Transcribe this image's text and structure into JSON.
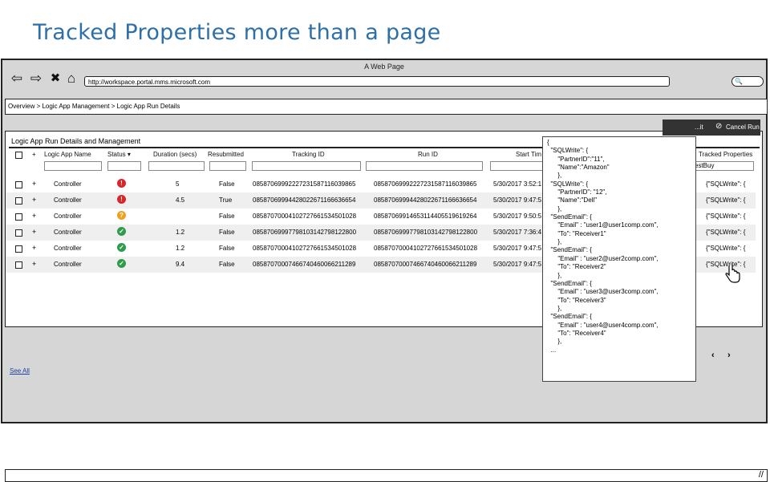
{
  "slide_title": "Tracked Properties more than a page",
  "window": {
    "title": "A Web Page",
    "url": "http://workspace.portal.mms.microsoft.com",
    "nav": {
      "back": "⇦",
      "forward": "⇨",
      "stop": "✖",
      "home": "⌂"
    },
    "search_icon": "🔍"
  },
  "breadcrumb": "Overview > Logic App Management > Logic App Run Details",
  "panel": {
    "title": "Logic App Run Details and Management",
    "toolbar": {
      "resubmit_label": "...it",
      "cancel_label": "Cancel Run",
      "cancel_icon": "⊘"
    }
  },
  "table": {
    "columns": [
      "Logic App Name",
      "Status",
      "Duration (secs)",
      "Resubmitted",
      "Tracking ID",
      "Run ID",
      "Start Tim",
      "Tracked Properties"
    ],
    "sort_indicator": "▾",
    "first_filter_value": "estBuy",
    "rows": [
      {
        "name": "Controller",
        "status": "error",
        "duration": "5",
        "resubmitted": "False",
        "tracking_id": "08587069992227231587116039865",
        "run_id": "08587069992227231587116039865",
        "start": "5/30/2017 3:52:1",
        "tracked": "{\"SQLWrite\": {"
      },
      {
        "name": "Controller",
        "status": "error",
        "duration": "4.5",
        "resubmitted": "True",
        "tracking_id": "08587069994428022671166636654",
        "run_id": "08587069994428022671166636654",
        "start": "5/30/2017 9:47:5",
        "tracked": "{\"SQLWrite\": {"
      },
      {
        "name": "Controller",
        "status": "warning",
        "duration": "",
        "resubmitted": "False",
        "tracking_id": "08587070004102727661534501028",
        "run_id": "08587069914653114405519619264",
        "start": "5/30/2017 9:50:5",
        "tracked": "{\"SQLWrite\": {"
      },
      {
        "name": "Controller",
        "status": "success",
        "duration": "1.2",
        "resubmitted": "False",
        "tracking_id": "08587069997798103142798122800",
        "run_id": "08587069997798103142798122800",
        "start": "5/30/2017 7:36:4",
        "tracked": "{\"SQLWrite\": {"
      },
      {
        "name": "Controller",
        "status": "success",
        "duration": "1.2",
        "resubmitted": "False",
        "tracking_id": "08587070004102727661534501028",
        "run_id": "08587070004102727661534501028",
        "start": "5/30/2017 9:47:5",
        "tracked": "{\"SQLWrite\": {"
      },
      {
        "name": "Controller",
        "status": "success",
        "duration": "9.4",
        "resubmitted": "False",
        "tracking_id": "08587070007466740460066211289",
        "run_id": "08587070007466740460066211289",
        "start": "5/30/2017 9:47:5",
        "tracked": "{\"SQLWrite\": {"
      }
    ],
    "status_colors": {
      "error": "#d9262b",
      "warning": "#f0a020",
      "success": "#2e9c4a"
    },
    "status_glyphs": {
      "error": "!",
      "warning": "?",
      "success": "✓"
    }
  },
  "pager": {
    "prev": "‹",
    "next": "›"
  },
  "see_all": "See All",
  "json_popup": "{\n  \"SQLWrite\": {\n      \"PartnerID\":\"11\",\n      \"Name\":\"Amazon\"\n      },\n  \"SQLWrite\": {\n      \"PartnerID\": \"12\",\n      \"Name\":\"Dell\"\n      },\n  \"SendEmail\": {\n      \"Email\" : \"user1@user1comp.com\",\n      \"To\": \"Receiver1\"\n      },\n  \"SendEmail\": {\n      \"Email\" : \"user2@user2comp.com\",\n      \"To\": \"Receiver2\"\n      },\n  \"SendEmail\": {\n      \"Email\" : \"user3@user3comp.com\",\n      \"To\": \"Receiver3\"\n      },\n  \"SendEmail\": {\n      \"Email\" : \"user4@user4comp.com\",\n      \"To\": \"Receiver4\"\n      },\n  ..."
}
